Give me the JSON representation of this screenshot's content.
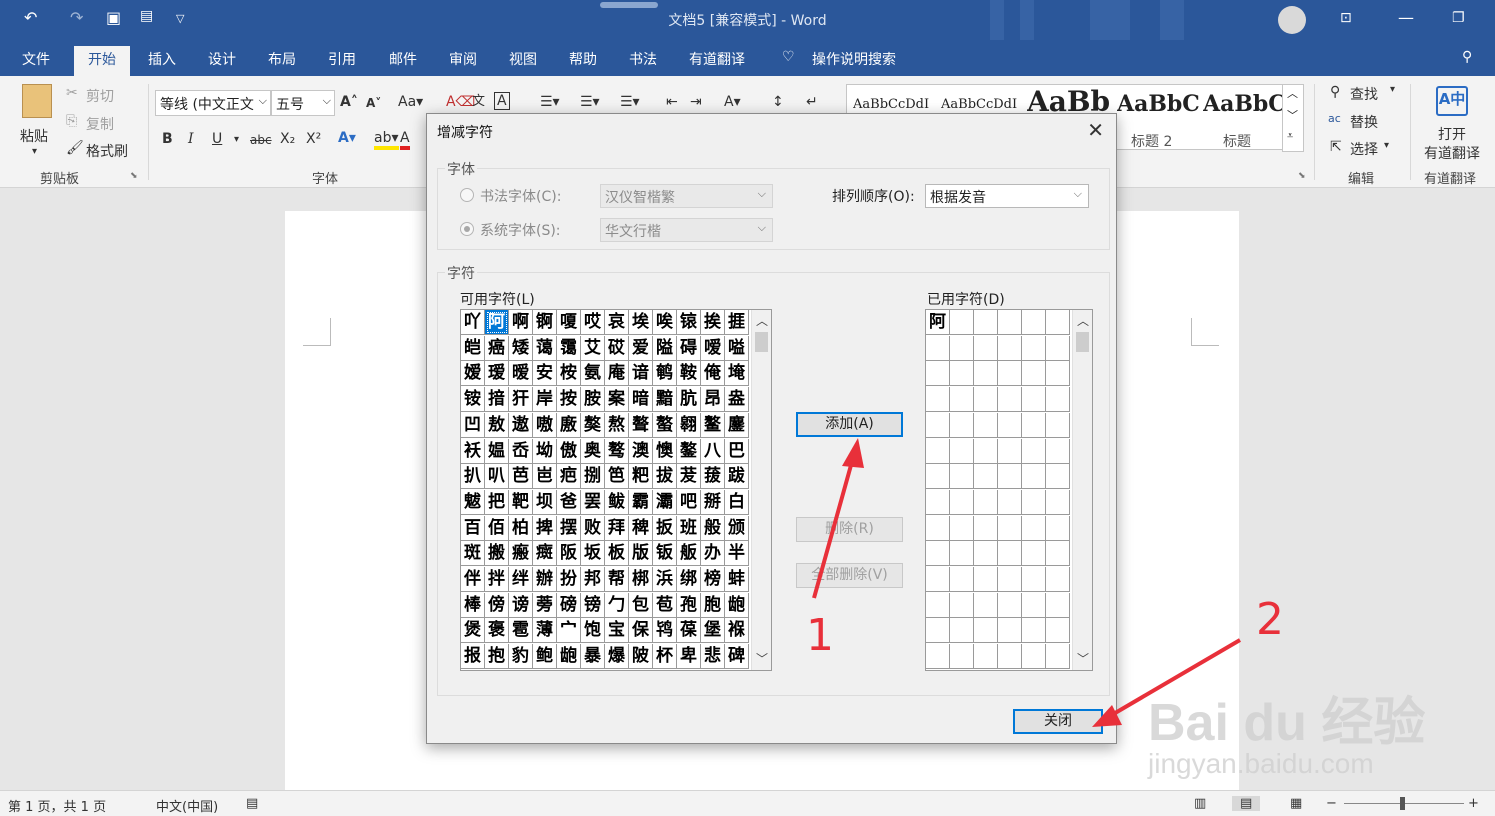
{
  "app": {
    "title": "文档5 [兼容模式]  -  Word"
  },
  "quick_access": {
    "undo": "↶",
    "redo": "↷",
    "save": "💾"
  },
  "menu": {
    "tabs": [
      "文件",
      "开始",
      "插入",
      "设计",
      "布局",
      "引用",
      "邮件",
      "审阅",
      "视图",
      "帮助",
      "书法",
      "有道翻译"
    ],
    "search": "操作说明搜索"
  },
  "ribbon": {
    "clipboard": {
      "paste": "粘贴",
      "cut": "剪切",
      "copy": "复制",
      "format_painter": "格式刷",
      "group": "剪贴板"
    },
    "font": {
      "name": "等线 (中文正文",
      "size": "五号",
      "group": "字体",
      "bold": "B",
      "italic": "I",
      "underline": "U",
      "strike": "abc",
      "sub": "X₂",
      "sup": "X²"
    },
    "styles": [
      {
        "preview": "AaBbCcDdI",
        "name": ""
      },
      {
        "preview": "AaBbCcDdI",
        "name": ""
      },
      {
        "preview": "AaBb",
        "name": ""
      },
      {
        "preview": "AaBbC",
        "name": "标题 2"
      },
      {
        "preview": "AaBbC",
        "name": "标题"
      }
    ],
    "editing": {
      "find": "查找",
      "replace": "替换",
      "select": "选择",
      "group": "编辑"
    },
    "youdao": {
      "open": "打开",
      "open2": "有道翻译",
      "group": "有道翻译"
    }
  },
  "status": {
    "page": "第 1 页，共 1 页",
    "lang": "中文(中国)"
  },
  "dialog": {
    "title": "增减字符",
    "font_section": "字体",
    "calligraphy_label": "书法字体(C):",
    "calligraphy_value": "汉仪智楷繁",
    "system_label": "系统字体(S):",
    "system_value": "华文行楷",
    "sort_label": "排列顺序(O):",
    "sort_value": "根据发音",
    "chars_section": "字符",
    "available_label": "可用字符(L)",
    "used_label": "已用字符(D)",
    "available_chars": [
      [
        "吖",
        "阿",
        "啊",
        "锕",
        "嗄",
        "哎",
        "哀",
        "埃",
        "唉",
        "锿",
        "挨",
        "捱"
      ],
      [
        "皑",
        "癌",
        "矮",
        "蔼",
        "霭",
        "艾",
        "砹",
        "爱",
        "隘",
        "碍",
        "嗳",
        "嗌"
      ],
      [
        "嫒",
        "瑷",
        "暧",
        "安",
        "桉",
        "氨",
        "庵",
        "谙",
        "鹌",
        "鞍",
        "俺",
        "埯"
      ],
      [
        "铵",
        "揞",
        "犴",
        "岸",
        "按",
        "胺",
        "案",
        "暗",
        "黯",
        "肮",
        "昂",
        "盎"
      ],
      [
        "凹",
        "敖",
        "遨",
        "嗷",
        "廒",
        "獒",
        "熬",
        "聱",
        "螯",
        "翱",
        "鳌",
        "鏖"
      ],
      [
        "袄",
        "媪",
        "岙",
        "坳",
        "傲",
        "奥",
        "骜",
        "澳",
        "懊",
        "鏊",
        "八",
        "巴"
      ],
      [
        "扒",
        "叭",
        "芭",
        "岜",
        "疤",
        "捌",
        "笆",
        "粑",
        "拔",
        "茇",
        "菝",
        "跋"
      ],
      [
        "魃",
        "把",
        "靶",
        "坝",
        "爸",
        "罢",
        "鲅",
        "霸",
        "灞",
        "吧",
        "掰",
        "白"
      ],
      [
        "百",
        "佰",
        "柏",
        "捭",
        "摆",
        "败",
        "拜",
        "稗",
        "扳",
        "班",
        "般",
        "颁"
      ],
      [
        "斑",
        "搬",
        "瘢",
        "癍",
        "阪",
        "坂",
        "板",
        "版",
        "钣",
        "舨",
        "办",
        "半"
      ],
      [
        "伴",
        "拌",
        "绊",
        "辦",
        "扮",
        "邦",
        "帮",
        "梆",
        "浜",
        "绑",
        "榜",
        "蚌"
      ],
      [
        "棒",
        "傍",
        "谤",
        "蒡",
        "磅",
        "镑",
        "勹",
        "包",
        "苞",
        "孢",
        "胞",
        "龅"
      ],
      [
        "煲",
        "褒",
        "雹",
        "薄",
        "宀",
        "饱",
        "宝",
        "保",
        "鸨",
        "葆",
        "堡",
        "褓"
      ],
      [
        "报",
        "抱",
        "豹",
        "鲍",
        "龅",
        "暴",
        "爆",
        "陂",
        "杯",
        "卑",
        "悲",
        "碑"
      ]
    ],
    "used_chars": [
      "阿"
    ],
    "add_btn": "添加(A)",
    "delete_btn": "删除(R)",
    "delete_all_btn": "全部删除(V)",
    "close_btn": "关闭"
  },
  "annotations": {
    "one": "1",
    "two": "2"
  },
  "watermark": {
    "logo": "Bai du 经验",
    "url": "jingyan.baidu.com"
  },
  "colors": {
    "word_blue": "#2b579a",
    "annot_red": "#e8303a",
    "select_blue": "#0078d7"
  }
}
